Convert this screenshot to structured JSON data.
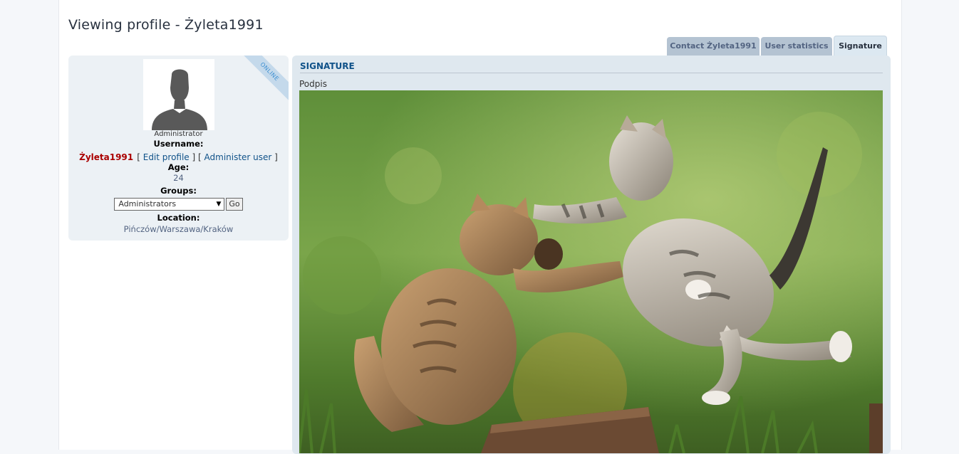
{
  "page": {
    "title": "Viewing profile - Żyleta1991"
  },
  "tabs": [
    {
      "label": "Contact Żyleta1991",
      "active": false
    },
    {
      "label": "User statistics",
      "active": false
    },
    {
      "label": "Signature",
      "active": true
    }
  ],
  "profile": {
    "status_ribbon": "ONLINE",
    "avatar_icon": "default-avatar-silhouette",
    "rank": "Administrator",
    "username_label": "Username:",
    "username": "Żyleta1991",
    "edit_profile": "Edit profile",
    "administer_user": "Administer user",
    "age_label": "Age:",
    "age": "24",
    "groups_label": "Groups:",
    "groups_selected": "Administrators",
    "go_button": "Go",
    "location_label": "Location:",
    "location": "Pińczów/Warszawa/Kraków"
  },
  "signature": {
    "heading": "SIGNATURE",
    "text": "Podpis",
    "image_icon": "two-kittens-playing-photo"
  },
  "colors": {
    "username": "#aa0000",
    "link": "#105289",
    "panel_bg": "#ecf1f5",
    "tab_active_bg": "#dce8f1",
    "tab_bg": "#b4c3d2"
  }
}
